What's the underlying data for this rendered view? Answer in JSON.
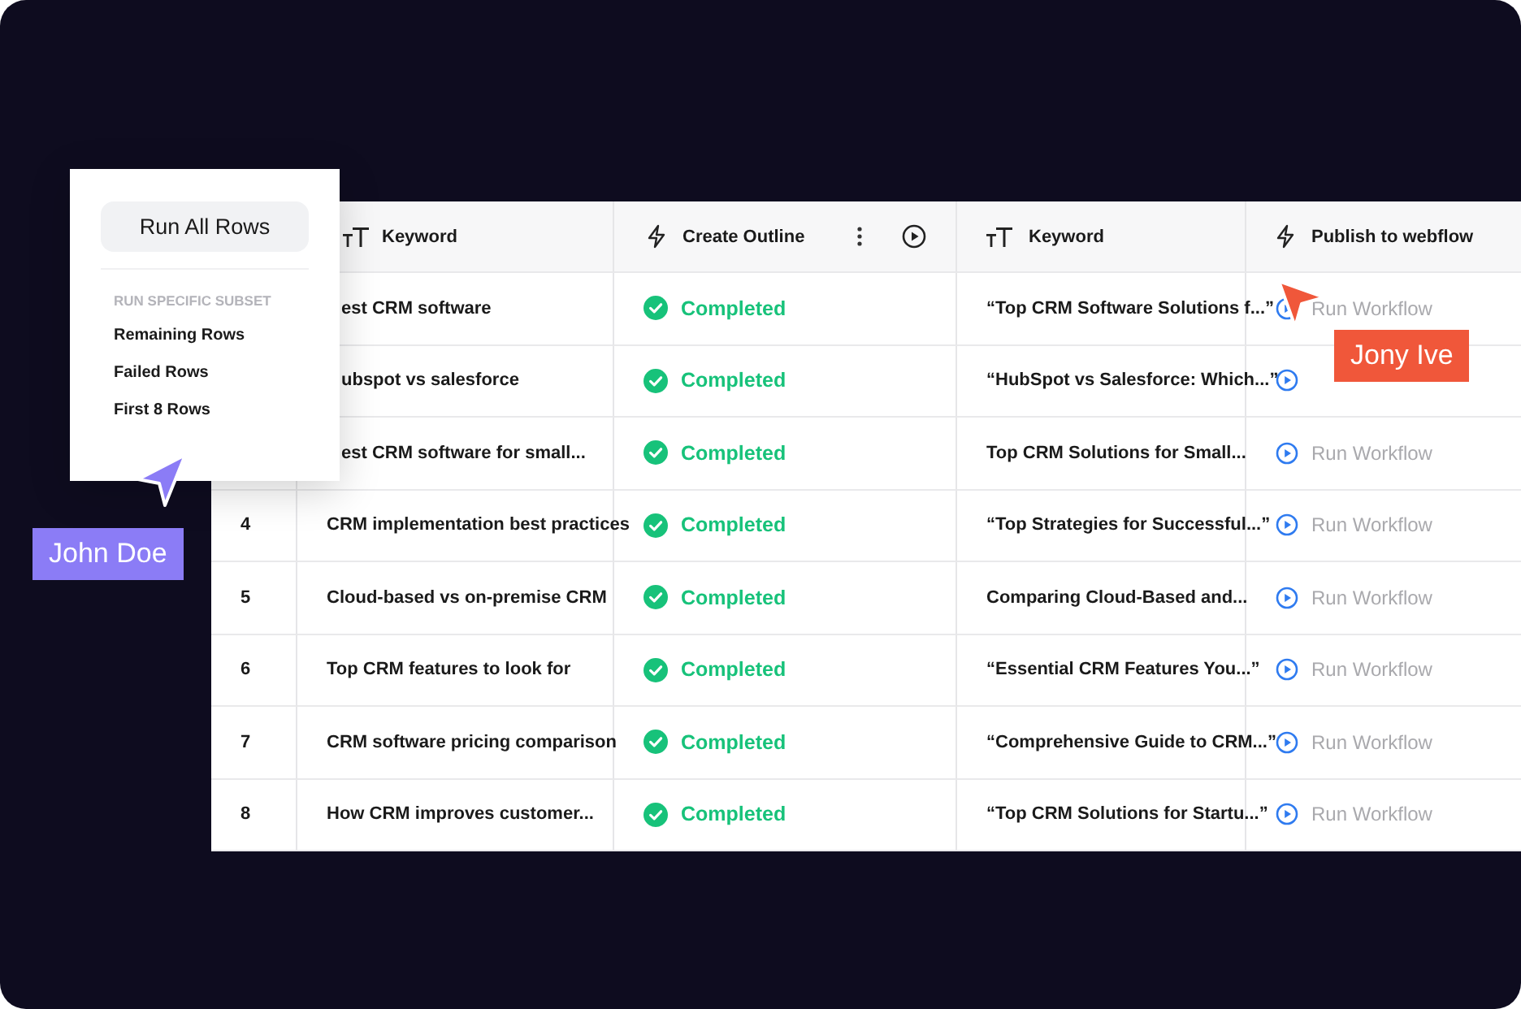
{
  "table": {
    "columns": [
      {
        "kind": "text",
        "label": "Keyword"
      },
      {
        "kind": "ai",
        "label": "Create Outline",
        "has_controls": true
      },
      {
        "kind": "text",
        "label": "Keyword"
      },
      {
        "kind": "ai",
        "label": "Publish to webflow"
      }
    ],
    "rows": [
      {
        "keyword": "est CRM software",
        "status": {
          "kind": "completed",
          "label": "Completed"
        },
        "title": "“Top CRM Software Solutions f...”",
        "action": {
          "kind": "run",
          "label": "Run Workflow"
        }
      },
      {
        "keyword": "ubspot vs salesforce",
        "status": {
          "kind": "completed",
          "label": "Completed"
        },
        "title": "“HubSpot vs Salesforce: Which...”",
        "action": {
          "kind": "run"
        }
      },
      {
        "keyword": "est CRM software for small...",
        "status": {
          "kind": "completed",
          "label": "Completed"
        },
        "title": "Top CRM Solutions for Small...",
        "action": {
          "kind": "run",
          "label": "Run Workflow"
        }
      },
      {
        "number": "4",
        "keyword": "CRM implementation best practices",
        "status": {
          "kind": "completed",
          "label": "Completed"
        },
        "title": "“Top Strategies for Successful...”",
        "action": {
          "kind": "run",
          "label": "Run Workflow"
        }
      },
      {
        "number": "5",
        "keyword": "Cloud-based vs on-premise CRM",
        "status": {
          "kind": "completed",
          "label": "Completed"
        },
        "title": "Comparing Cloud-Based and...",
        "action": {
          "kind": "run",
          "label": "Run Workflow"
        }
      },
      {
        "number": "6",
        "keyword": "Top CRM features to look for",
        "status": {
          "kind": "completed",
          "label": "Completed"
        },
        "title": "“Essential CRM Features You...”",
        "action": {
          "kind": "run",
          "label": "Run Workflow"
        }
      },
      {
        "number": "7",
        "keyword": "CRM software pricing comparison",
        "status": {
          "kind": "completed",
          "label": "Completed"
        },
        "title": "“Comprehensive Guide to CRM...”",
        "action": {
          "kind": "run",
          "label": "Run Workflow"
        }
      },
      {
        "number": "8",
        "keyword": "How CRM improves customer...",
        "status": {
          "kind": "completed",
          "label": "Completed"
        },
        "title": "“Top CRM Solutions for Startu...”",
        "action": {
          "kind": "run",
          "label": "Run Workflow"
        }
      }
    ]
  },
  "run_menu": {
    "primary_button": "Run All Rows",
    "section_heading": "RUN SPECIFIC SUBSET",
    "items": [
      "Remaining Rows",
      "Failed Rows",
      "First 8 Rows"
    ]
  },
  "cursors": [
    {
      "name": "John Doe",
      "color": "#8b7cf6",
      "kind": "up-right"
    },
    {
      "name": "Jony Ive",
      "color": "#f0573a",
      "kind": "up-left"
    }
  ]
}
